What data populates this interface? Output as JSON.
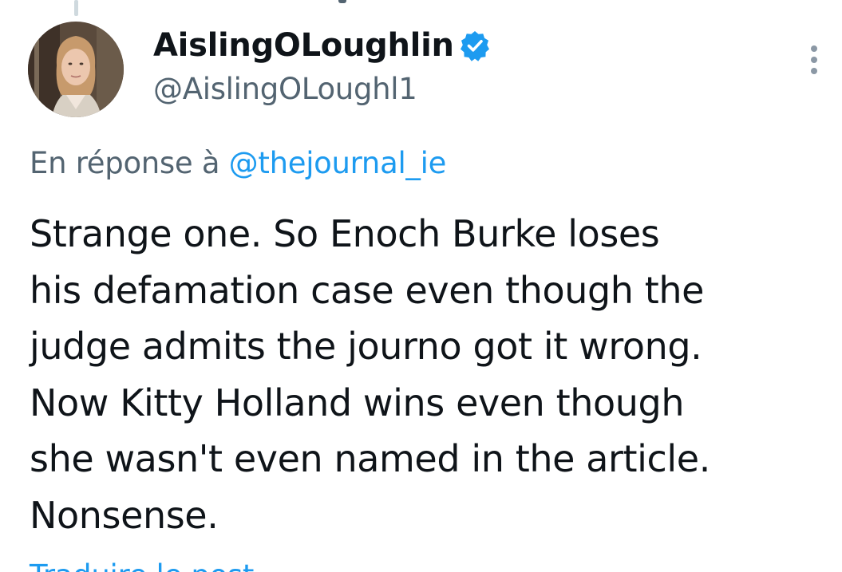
{
  "tweet": {
    "author": {
      "display_name": "AislingOLoughlin",
      "handle": "@AislingOLoughl1",
      "verified": true,
      "avatar_icon": "profile-photo-woman"
    },
    "reply_context": {
      "prefix": "En réponse à",
      "mention": "@thejournal_ie"
    },
    "text_lines": [
      "Strange one. So Enoch Burke loses",
      "his defamation case even though the",
      "judge admits the journo got it wrong.",
      "Now Kitty Holland wins even though",
      "she wasn't even named in the article.",
      "Nonsense."
    ],
    "translate_label": "Traduire le post",
    "more_icon": "vertical-ellipsis-icon"
  },
  "colors": {
    "text": "#0f1419",
    "secondary": "#536471",
    "link": "#1d9bf0",
    "verified_badge": "#1d9bf0",
    "thread_line": "#cfd9de"
  }
}
